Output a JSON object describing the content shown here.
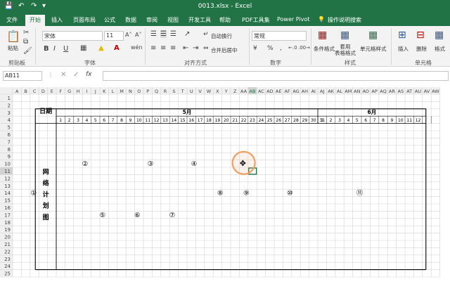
{
  "app": {
    "title": "0013.xlsx  -  Excel"
  },
  "tabs": [
    "文件",
    "开始",
    "插入",
    "页面布局",
    "公式",
    "数据",
    "审阅",
    "视图",
    "开发工具",
    "帮助",
    "PDF工具集",
    "Power Pivot",
    "操作说明搜索"
  ],
  "ribbon": {
    "paste": "粘贴",
    "clipboard": "剪贴板",
    "font_name": "宋体",
    "font_size": "11",
    "font": "字体",
    "bold": "B",
    "italic": "I",
    "underline": "U",
    "wrap": "自动换行",
    "merge": "合并后居中",
    "alignment": "对齐方式",
    "num_format": "常规",
    "number": "数字",
    "cond_fmt": "条件格式",
    "table_fmt": "套用\n表格格式",
    "cell_style": "单元格样式",
    "styles": "样式",
    "insert": "插入",
    "delete": "删除",
    "format": "格式",
    "cells": "单元格"
  },
  "formula_bar": {
    "name_box": "AB11",
    "fx": "fx",
    "value": ""
  },
  "col_headers": [
    "A",
    "B",
    "C",
    "D",
    "E",
    "F",
    "G",
    "H",
    "I",
    "J",
    "K",
    "L",
    "M",
    "N",
    "O",
    "P",
    "Q",
    "R",
    "S",
    "T",
    "U",
    "V",
    "W",
    "X",
    "Y",
    "Z",
    "AA",
    "AB",
    "AC",
    "AD",
    "AE",
    "AF",
    "AG",
    "AH",
    "AI",
    "AJ",
    "AK",
    "AL",
    "AM",
    "AN",
    "AO",
    "AP",
    "AQ",
    "AR",
    "AS",
    "AT",
    "AU",
    "AV",
    "AW"
  ],
  "row_headers": [
    "1",
    "2",
    "3",
    "4",
    "5",
    "6",
    "7",
    "8",
    "9",
    "10",
    "11",
    "12",
    "13",
    "14",
    "15",
    "16",
    "17",
    "18",
    "19",
    "20",
    "21",
    "22",
    "23",
    "24",
    "25"
  ],
  "sheet": {
    "date_label": "日期",
    "month1": "5月",
    "month2": "6月",
    "days1": [
      "1",
      "2",
      "3",
      "4",
      "5",
      "6",
      "7",
      "8",
      "9",
      "10",
      "11",
      "12",
      "13",
      "14",
      "15",
      "16",
      "17",
      "18",
      "19",
      "20",
      "21",
      "22",
      "23",
      "24",
      "25",
      "26",
      "27",
      "28",
      "29",
      "30",
      "31"
    ],
    "days2": [
      "1",
      "2",
      "3",
      "4",
      "5",
      "6",
      "7",
      "8",
      "9",
      "10",
      "11",
      "12"
    ],
    "side_label": [
      "网",
      "络",
      "计",
      "划",
      "图"
    ],
    "nodes": [
      "①",
      "②",
      "③",
      "④",
      "⑤",
      "⑥",
      "⑦",
      "⑧",
      "⑨",
      "⑩",
      "⑪"
    ]
  },
  "colors": {
    "excel_green": "#217346",
    "gridline": "#d4d4d4",
    "header_bg": "#f0f0f0",
    "cursor_ring": "#f0a060"
  }
}
